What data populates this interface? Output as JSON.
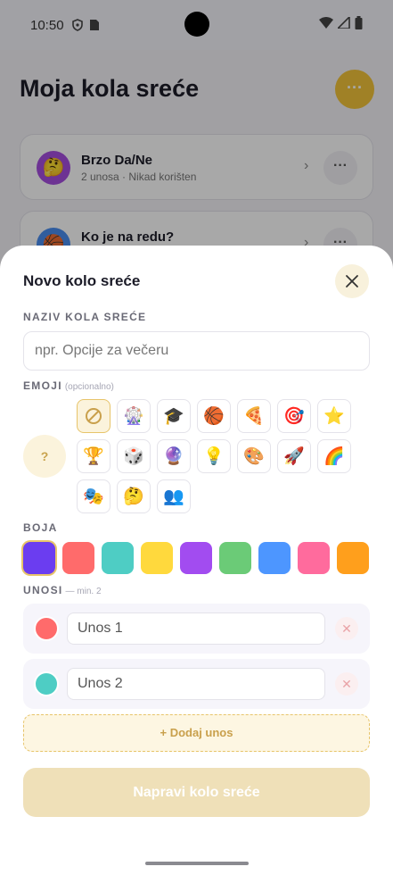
{
  "status": {
    "time": "10:50"
  },
  "page": {
    "title": "Moja kola sreće",
    "fab_label": "···",
    "cards": [
      {
        "emoji": "🤔",
        "title": "Brzo Da/Ne",
        "subtitle": "2 unosa · Nikad korišten",
        "avatar_color": "#a64ee0"
      },
      {
        "emoji": "🏀",
        "title": "Ko je na redu?",
        "subtitle": "",
        "avatar_color": "#4a8ef0"
      }
    ],
    "card_more": "···",
    "card_chevron": "›"
  },
  "sheet": {
    "title": "Novo kolo sreće",
    "name_label": "NAZIV KOLA SREĆE",
    "name_placeholder": "npr. Opcije za večeru",
    "emoji_label": "EMOJI",
    "emoji_hint": "(opcionalno)",
    "emoji_preview": "?",
    "emojis": [
      "∅",
      "🎡",
      "🎓",
      "🏀",
      "🍕",
      "🎯",
      "⭐",
      "🏆",
      "🎲",
      "🔮",
      "💡",
      "🎨",
      "🚀",
      "🌈",
      "🎭",
      "🤔",
      "👥"
    ],
    "color_label": "BOJA",
    "colors": [
      "#6b3df0",
      "#ff6b6b",
      "#4ecdc4",
      "#ffd93d",
      "#a24cf0",
      "#6bcb77",
      "#4d96ff",
      "#ff6b9d",
      "#ff9f1c"
    ],
    "entries_label": "UNOSI",
    "entries_hint": "— min. 2",
    "entries": [
      {
        "placeholder": "Unos 1",
        "color": "#ff6b6b"
      },
      {
        "placeholder": "Unos 2",
        "color": "#4ecdc4"
      }
    ],
    "add_label": "+ Dodaj unos",
    "create_label": "Napravi kolo sreće"
  }
}
